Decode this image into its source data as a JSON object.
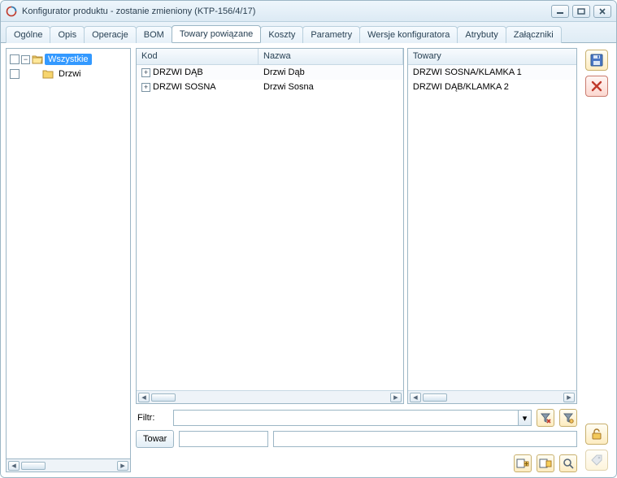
{
  "window": {
    "title": "Konfigurator produktu - zostanie zmieniony  (KTP-156/4/17)"
  },
  "tabs": [
    {
      "label": "Ogólne"
    },
    {
      "label": "Opis"
    },
    {
      "label": "Operacje"
    },
    {
      "label": "BOM"
    },
    {
      "label": "Towary powiązane"
    },
    {
      "label": "Koszty"
    },
    {
      "label": "Parametry"
    },
    {
      "label": "Wersje konfiguratora"
    },
    {
      "label": "Atrybuty"
    },
    {
      "label": "Załączniki"
    }
  ],
  "activeTabIndex": 4,
  "tree": {
    "items": [
      {
        "label": "Wszystkie"
      },
      {
        "label": "Drzwi"
      }
    ]
  },
  "gridLeft": {
    "columns": {
      "kod": "Kod",
      "nazwa": "Nazwa"
    },
    "rows": [
      {
        "kod": "DRZWI DĄB",
        "nazwa": "Drzwi Dąb"
      },
      {
        "kod": "DRZWI SOSNA",
        "nazwa": "Drzwi Sosna"
      }
    ]
  },
  "gridRight": {
    "columns": {
      "towary": "Towary"
    },
    "rows": [
      {
        "towary": "DRZWI SOSNA/KLAMKA 1"
      },
      {
        "towary": "DRZWI DĄB/KLAMKA 2"
      }
    ]
  },
  "filter": {
    "label": "Filtr:",
    "value": ""
  },
  "towar": {
    "buttonLabel": "Towar",
    "value1": "",
    "value2": ""
  }
}
